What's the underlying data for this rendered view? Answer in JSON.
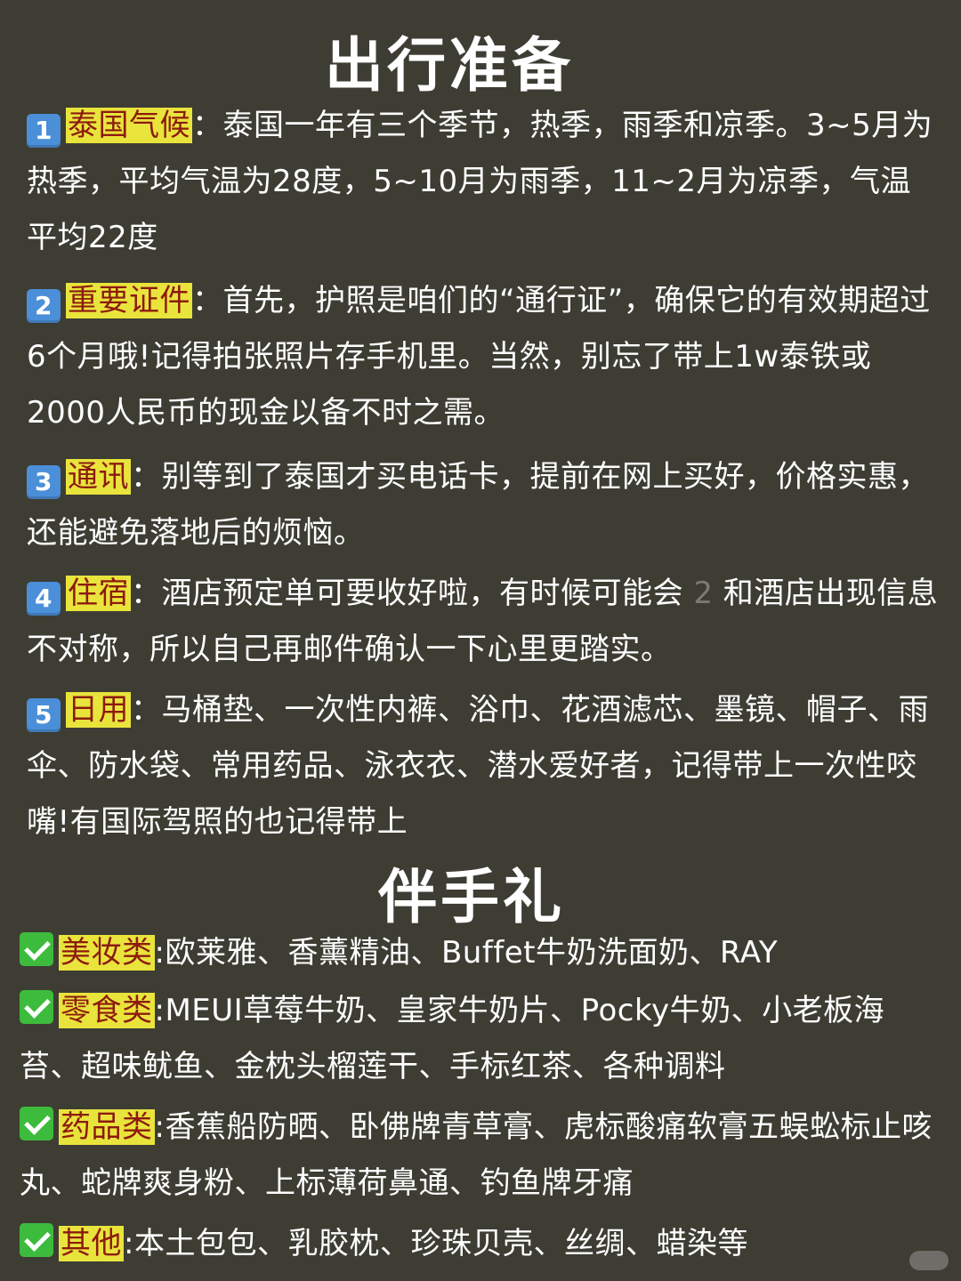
{
  "title": "出行准备",
  "sections": [
    {
      "badge": "1",
      "heading": "泰国气候",
      "colon": "：",
      "text": "泰国一年有三个季节，热季，雨季和凉季。3~5月为热季，平均气温为28度，5~10月为雨季，11~2月为凉季，气温平均22度"
    },
    {
      "badge": "2",
      "heading": "重要证件",
      "colon": "：",
      "text": "首先，护照是咱们的“通行证”，确保它的有效期超过6个月哦!记得拍张照片存手机里。当然，别忘了带上1w泰铁或2000人民币的现金以备不时之需。"
    },
    {
      "badge": "3",
      "heading": "通讯",
      "colon": "：",
      "text": "别等到了泰国才买电话卡，提前在网上买好，价格实惠，还能避免落地后的烦恼。"
    },
    {
      "badge": "4",
      "heading": "住宿",
      "colon": "：",
      "text_a": "酒店预定单可要收好啦，有时候可能会",
      "faint": "2",
      "text_b": "和酒店出现信息不对称，所以自己再邮件确认一下心里更踏实。"
    },
    {
      "badge": "5",
      "heading": "日用",
      "colon": "：",
      "text": "马桶垫、一次性内裤、浴巾、花酒滤芯、墨镜、帽子、雨伞、防水袋、常用药品、泳衣衣、潜水爱好者，记得带上一次性咬嘴!有国际驾照的也记得带上"
    }
  ],
  "gift_title": "伴手礼",
  "gifts": [
    {
      "heading": "美妆类",
      "text": ":欧莱雅、香薰精油、Buffet牛奶洗面奶、RAY"
    },
    {
      "heading": "零食类",
      "text": ":MEUI草莓牛奶、皇家牛奶片、Pocky牛奶、小老板海苔、超味鱿鱼、金枕头榴莲干、手标红茶、各种调料"
    },
    {
      "heading": "药品类",
      "text": ":香蕉船防晒、卧佛牌青草膏、虎标酸痛软膏五蜈蚣标止咳丸、蛇牌爽身粉、上标薄荷鼻通、钓鱼牌牙痛"
    },
    {
      "heading": "其他",
      "text": ":本土包包、乳胶枕、珍珠贝壳、丝绸、蜡染等"
    }
  ],
  "colors": {
    "background": "#3e3d34",
    "highlight_bg": "#e9e43c",
    "highlight_text": "#8c1b0f",
    "badge": "#4a8fd8",
    "check": "#3dbb3d"
  }
}
